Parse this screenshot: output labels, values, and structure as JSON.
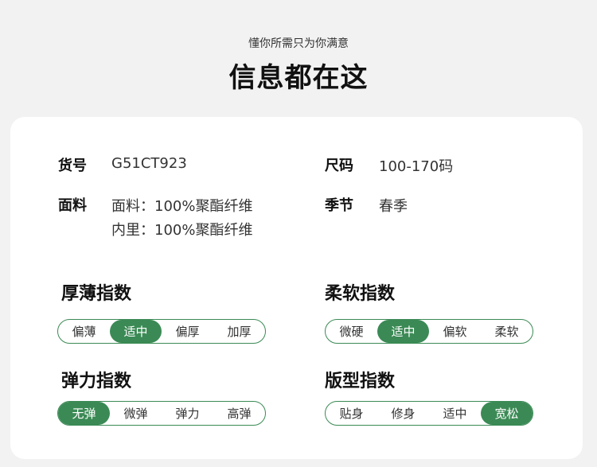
{
  "header": {
    "subtitle": "懂你所需只为你满意",
    "title": "信息都在这"
  },
  "info": {
    "sku_label": "货号",
    "sku_value": "G51CT923",
    "size_label": "尺码",
    "size_value": "100-170码",
    "fabric_label": "面料",
    "fabric_line1": "面料：100%聚酯纤维",
    "fabric_line2": "内里：100%聚酯纤维",
    "season_label": "季节",
    "season_value": "春季"
  },
  "indices": {
    "thickness": {
      "title": "厚薄指数",
      "options": [
        "偏薄",
        "适中",
        "偏厚",
        "加厚"
      ],
      "selected": "适中"
    },
    "softness": {
      "title": "柔软指数",
      "options": [
        "微硬",
        "适中",
        "偏软",
        "柔软"
      ],
      "selected": "适中"
    },
    "elasticity": {
      "title": "弹力指数",
      "options": [
        "无弹",
        "微弹",
        "弹力",
        "高弹"
      ],
      "selected": "无弹"
    },
    "fit": {
      "title": "版型指数",
      "options": [
        "贴身",
        "修身",
        "适中",
        "宽松"
      ],
      "selected": "宽松"
    }
  },
  "colors": {
    "accent": "#3b8a55",
    "card": "#ffffff",
    "background": "#f2f2f2"
  }
}
